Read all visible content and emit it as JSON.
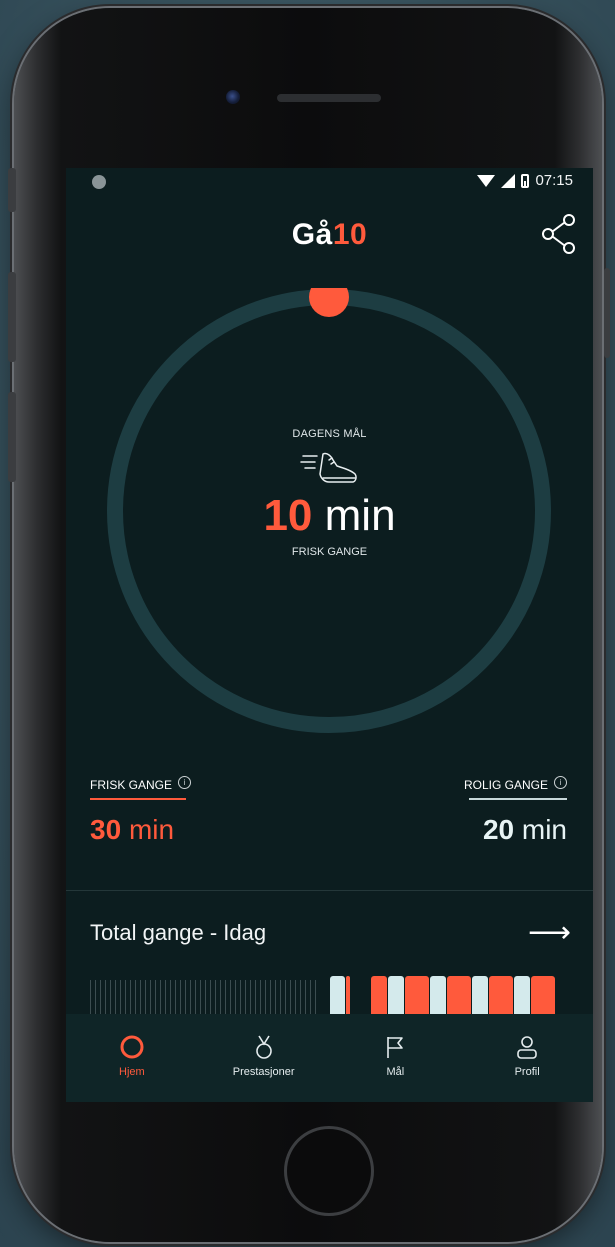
{
  "status_bar": {
    "time": "07:15"
  },
  "app": {
    "title_part1": "Gå",
    "title_part2": "10"
  },
  "goal": {
    "label": "DAGENS MÅL",
    "value_number": "10",
    "value_unit": "min",
    "subtitle": "FRISK GANGE",
    "progress": 0.0
  },
  "stats": {
    "brisk": {
      "label": "FRISK GANGE",
      "value_number": "30",
      "value_unit": "min"
    },
    "calm": {
      "label": "ROLIG GANGE",
      "value_number": "20",
      "value_unit": "min"
    }
  },
  "total": {
    "label": "Total gange - Idag"
  },
  "nav": {
    "items": [
      {
        "label": "Hjem",
        "icon": "home-ring-icon",
        "active": true
      },
      {
        "label": "Prestasjoner",
        "icon": "medal-icon",
        "active": false
      },
      {
        "label": "Mål",
        "icon": "flag-icon",
        "active": false
      },
      {
        "label": "Profil",
        "icon": "person-icon",
        "active": false
      }
    ]
  },
  "colors": {
    "accent": "#ff5a3c",
    "background": "#0c1d1f",
    "ring": "#1d3d42",
    "calm": "#d4eaec"
  }
}
